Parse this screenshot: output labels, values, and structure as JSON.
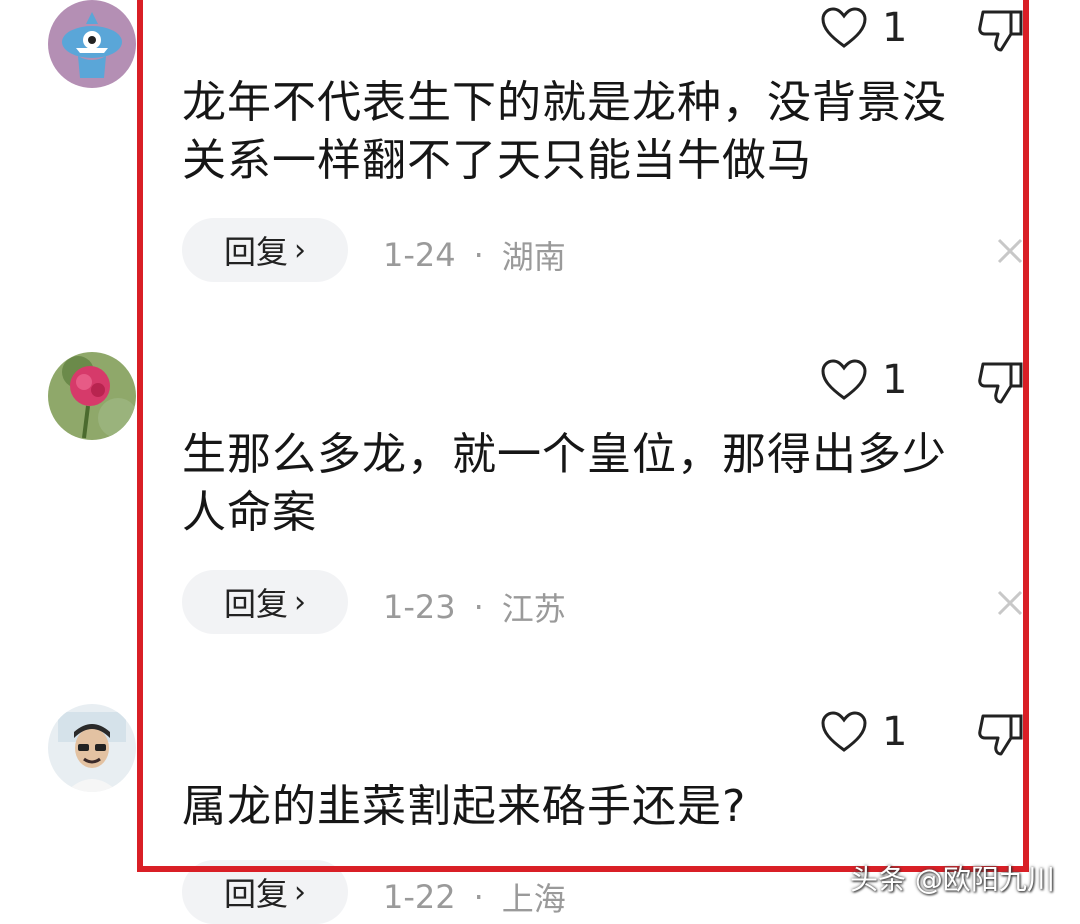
{
  "comments": [
    {
      "likes": "1",
      "text_line1": "龙年不代表生下的就是龙种，没背景没",
      "text_line2": "关系一样翻不了天只能当牛做马",
      "reply_label": "回复",
      "date": "1-24",
      "separator": "·",
      "location": "湖南"
    },
    {
      "likes": "1",
      "text_line1": "生那么多龙，就一个皇位，那得出多少",
      "text_line2": "人命案",
      "reply_label": "回复",
      "date": "1-23",
      "separator": "·",
      "location": "江苏"
    },
    {
      "likes": "1",
      "text_line1": "属龙的韭菜割起来硌手还是?",
      "text_line2": "",
      "reply_label": "回复",
      "date": "1-22",
      "separator": "·",
      "location": "上海"
    }
  ],
  "watermark": "头条 @欧阳九川",
  "colors": {
    "highlight_frame": "#d91f26",
    "reply_bg": "#f2f3f5",
    "meta_text": "#9a9a9a"
  }
}
